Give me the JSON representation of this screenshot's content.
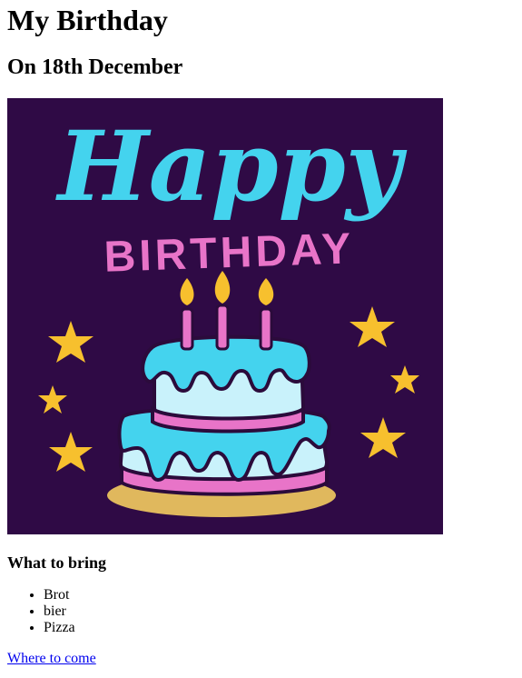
{
  "page": {
    "title": "My Birthday",
    "subtitle": "On 18th December"
  },
  "image": {
    "headline": "Happy",
    "subline": "BIRTHDAY",
    "colors": {
      "background": "#2f0a45",
      "cyan": "#44d3ee",
      "pink": "#e874c8",
      "yellow": "#f7c02e",
      "plate": "#e0b85d",
      "light": "#c9f2fb",
      "dark": "#2b0b3b"
    }
  },
  "section": {
    "heading": "What to bring",
    "items": [
      "Brot",
      "bier",
      "Pizza"
    ]
  },
  "link": {
    "label": "Where to come"
  }
}
